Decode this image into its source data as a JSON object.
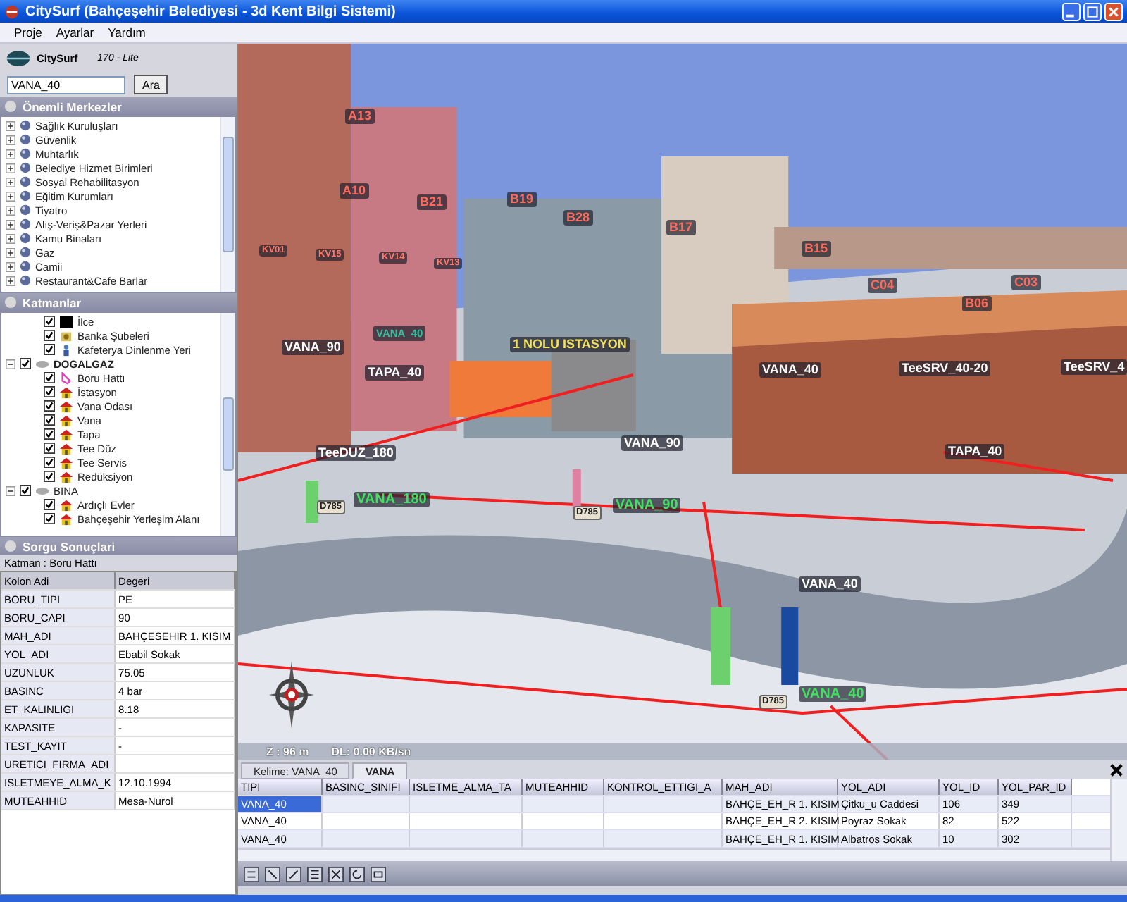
{
  "window": {
    "title": "CitySurf  (Bahçeşehir Belediyesi - 3d Kent Bilgi Sistemi)"
  },
  "menu": [
    "Proje",
    "Ayarlar",
    "Yardım"
  ],
  "logo": {
    "name": "CitySurf",
    "version": "170 - Lite"
  },
  "search": {
    "value": "VANA_40",
    "button": "Ara"
  },
  "centers": {
    "title": "Önemli Merkezler",
    "items": [
      "Sağlık Kuruluşları",
      "Güvenlik",
      "Muhtarlık",
      "Belediye Hizmet Birimleri",
      "Sosyal Rehabilitasyon",
      "Eğitim Kurumları",
      "Tiyatro",
      "Alış-Veriş&Pazar Yerleri",
      "Kamu Binaları",
      "Gaz",
      "Camii",
      "Restaurant&Cafe Barlar"
    ]
  },
  "layers": {
    "title": "Katmanlar",
    "tree": [
      {
        "kind": "area",
        "label": "İlce",
        "checked": true,
        "selected": false
      },
      {
        "kind": "bank",
        "label": "Banka Şubeleri",
        "checked": true,
        "selected": false
      },
      {
        "kind": "cafe",
        "label": "Kafeterya Dinlenme Yeri",
        "checked": true,
        "selected": false
      },
      {
        "kind": "group",
        "label": "DOGALGAZ",
        "checked": true,
        "selected": true,
        "expanded": true,
        "children": [
          {
            "kind": "line",
            "label": "Boru Hattı",
            "checked": true,
            "selected": false
          },
          {
            "kind": "point",
            "label": "İstasyon",
            "checked": true,
            "selected": false
          },
          {
            "kind": "point",
            "label": "Vana Odası",
            "checked": true,
            "selected": false
          },
          {
            "kind": "point",
            "label": "Vana",
            "checked": true,
            "selected": false
          },
          {
            "kind": "point",
            "label": "Tapa",
            "checked": true,
            "selected": false
          },
          {
            "kind": "point",
            "label": "Tee Düz",
            "checked": true,
            "selected": false
          },
          {
            "kind": "point",
            "label": "Tee Servis",
            "checked": true,
            "selected": false
          },
          {
            "kind": "point",
            "label": "Redüksiyon",
            "checked": true,
            "selected": false
          }
        ]
      },
      {
        "kind": "group",
        "label": "BINA",
        "checked": true,
        "selected": false,
        "expanded": true,
        "children": [
          {
            "kind": "point",
            "label": "Ardıçlı Evler",
            "checked": true,
            "selected": false
          },
          {
            "kind": "point",
            "label": "Bahçeşehir Yerleşim Alanı",
            "checked": true,
            "selected": false
          }
        ]
      }
    ]
  },
  "query": {
    "title": "Sorgu Sonuçlari",
    "layer": "Katman :  Boru Hattı",
    "columns": [
      "Kolon Adi",
      "Degeri"
    ],
    "rows": [
      [
        "BORU_TIPI",
        "PE"
      ],
      [
        "BORU_CAPI",
        "90"
      ],
      [
        "MAH_ADI",
        "BAHÇESEHIR 1. KISIM"
      ],
      [
        "YOL_ADI",
        "Ebabil Sokak"
      ],
      [
        "UZUNLUK",
        "75.05"
      ],
      [
        "BASINC",
        "4 bar"
      ],
      [
        "ET_KALINLIGI",
        "8.18"
      ],
      [
        "KAPASITE",
        "-"
      ],
      [
        "TEST_KAYIT",
        "-"
      ],
      [
        "URETICI_FIRMA_ADI",
        null
      ],
      [
        "ISLETMEYE_ALMA_K",
        "12.10.1994"
      ],
      [
        "MUTEAHHID",
        "Mesa-Nurol"
      ]
    ]
  },
  "map_labels": [
    {
      "text": "A13",
      "kind": "building"
    },
    {
      "text": "A10",
      "kind": "building"
    },
    {
      "text": "B21",
      "kind": "building"
    },
    {
      "text": "B19",
      "kind": "building"
    },
    {
      "text": "B28",
      "kind": "building"
    },
    {
      "text": "B17",
      "kind": "building"
    },
    {
      "text": "B15",
      "kind": "building"
    },
    {
      "text": "C04",
      "kind": "building"
    },
    {
      "text": "C03",
      "kind": "building"
    },
    {
      "text": "B06",
      "kind": "building"
    },
    {
      "text": "KV01",
      "kind": "small"
    },
    {
      "text": "KV15",
      "kind": "small"
    },
    {
      "text": "KV14",
      "kind": "small"
    },
    {
      "text": "KV13",
      "kind": "small"
    },
    {
      "text": "VANA_40",
      "kind": "teal"
    },
    {
      "text": "VANA_90",
      "kind": "object"
    },
    {
      "text": "TAPA_40",
      "kind": "object"
    },
    {
      "text": "1 NOLU ISTASYON",
      "kind": "station"
    },
    {
      "text": "VANA_40",
      "kind": "object"
    },
    {
      "text": "TeeSRV_40-20",
      "kind": "object"
    },
    {
      "text": "TeeSRV_4",
      "kind": "object"
    },
    {
      "text": "TeeDUZ_180",
      "kind": "object"
    },
    {
      "text": "VANA_90",
      "kind": "object"
    },
    {
      "text": "TAPA_40",
      "kind": "object"
    },
    {
      "text": "D785",
      "kind": "tag"
    },
    {
      "text": "VANA_180",
      "kind": "pipe"
    },
    {
      "text": "D785",
      "kind": "tag"
    },
    {
      "text": "VANA_90",
      "kind": "pipe"
    },
    {
      "text": "VANA_40",
      "kind": "object"
    },
    {
      "text": "D785",
      "kind": "tag"
    },
    {
      "text": "VANA_40",
      "kind": "pipe"
    }
  ],
  "view_status": [
    "Z : 96 m",
    "DL: 0.00 KB/sn"
  ],
  "results": {
    "tabs": [
      {
        "label": "Kelime: VANA_40",
        "selected": false
      },
      {
        "label": "VANA",
        "selected": true
      }
    ],
    "columns": [
      "TIPI",
      "BASINC_SINIFI",
      "ISLETME_ALMA_TA",
      "MUTEAHHID",
      "KONTROL_ETTIGI_A",
      "MAH_ADI",
      "YOL_ADI",
      "YOL_ID",
      "YOL_PAR_ID"
    ],
    "rows": [
      {
        "selected": true,
        "cells": [
          "VANA_40",
          null,
          null,
          null,
          null,
          "BAHÇE_EH_R 1. KISIM",
          "Çitku_u Caddesi",
          "106",
          "349"
        ]
      },
      {
        "selected": false,
        "cells": [
          "VANA_40",
          null,
          null,
          null,
          null,
          "BAHÇE_EH_R 2. KISIM",
          "Poyraz Sokak",
          "82",
          "522"
        ]
      },
      {
        "selected": false,
        "cells": [
          "VANA_40",
          null,
          null,
          null,
          null,
          "BAHÇE_EH_R 1. KISIM",
          "Albatros Sokak",
          "10",
          "302"
        ]
      }
    ]
  }
}
